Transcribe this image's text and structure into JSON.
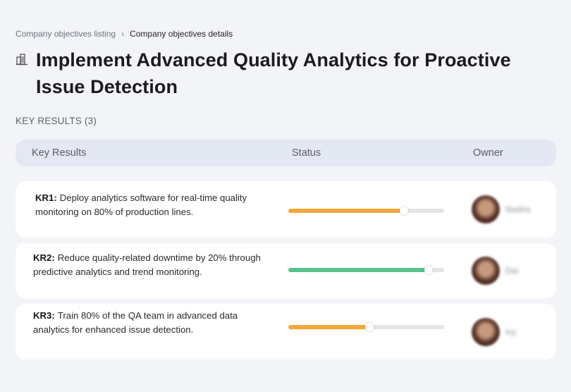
{
  "breadcrumb": {
    "parent": "Company objectives listing",
    "separator": "›",
    "current": "Company objectives details"
  },
  "page_title": "Implement Advanced Quality Analytics for Proactive Issue Detection",
  "title_icon": "building-icon",
  "section_label": "KEY RESULTS (3)",
  "table_header": {
    "key_results": "Key Results",
    "status": "Status",
    "owner": "Owner"
  },
  "key_results": [
    {
      "code": "KR1:",
      "text": "Deploy analytics software for real-time quality monitoring on 80% of production lines.",
      "progress": 0.74,
      "color": "#f6a73a",
      "owner": "Nadira"
    },
    {
      "code": "KR2:",
      "text": "Reduce quality-related downtime by 20% through predictive analytics and trend monitoring.",
      "progress": 0.9,
      "color": "#57c28a",
      "owner": "Dai"
    },
    {
      "code": "KR3:",
      "text": "Train 80% of the QA team in advanced data analytics for enhanced issue detection.",
      "progress": 0.52,
      "color": "#f6a73a",
      "owner": "Ivy"
    }
  ]
}
